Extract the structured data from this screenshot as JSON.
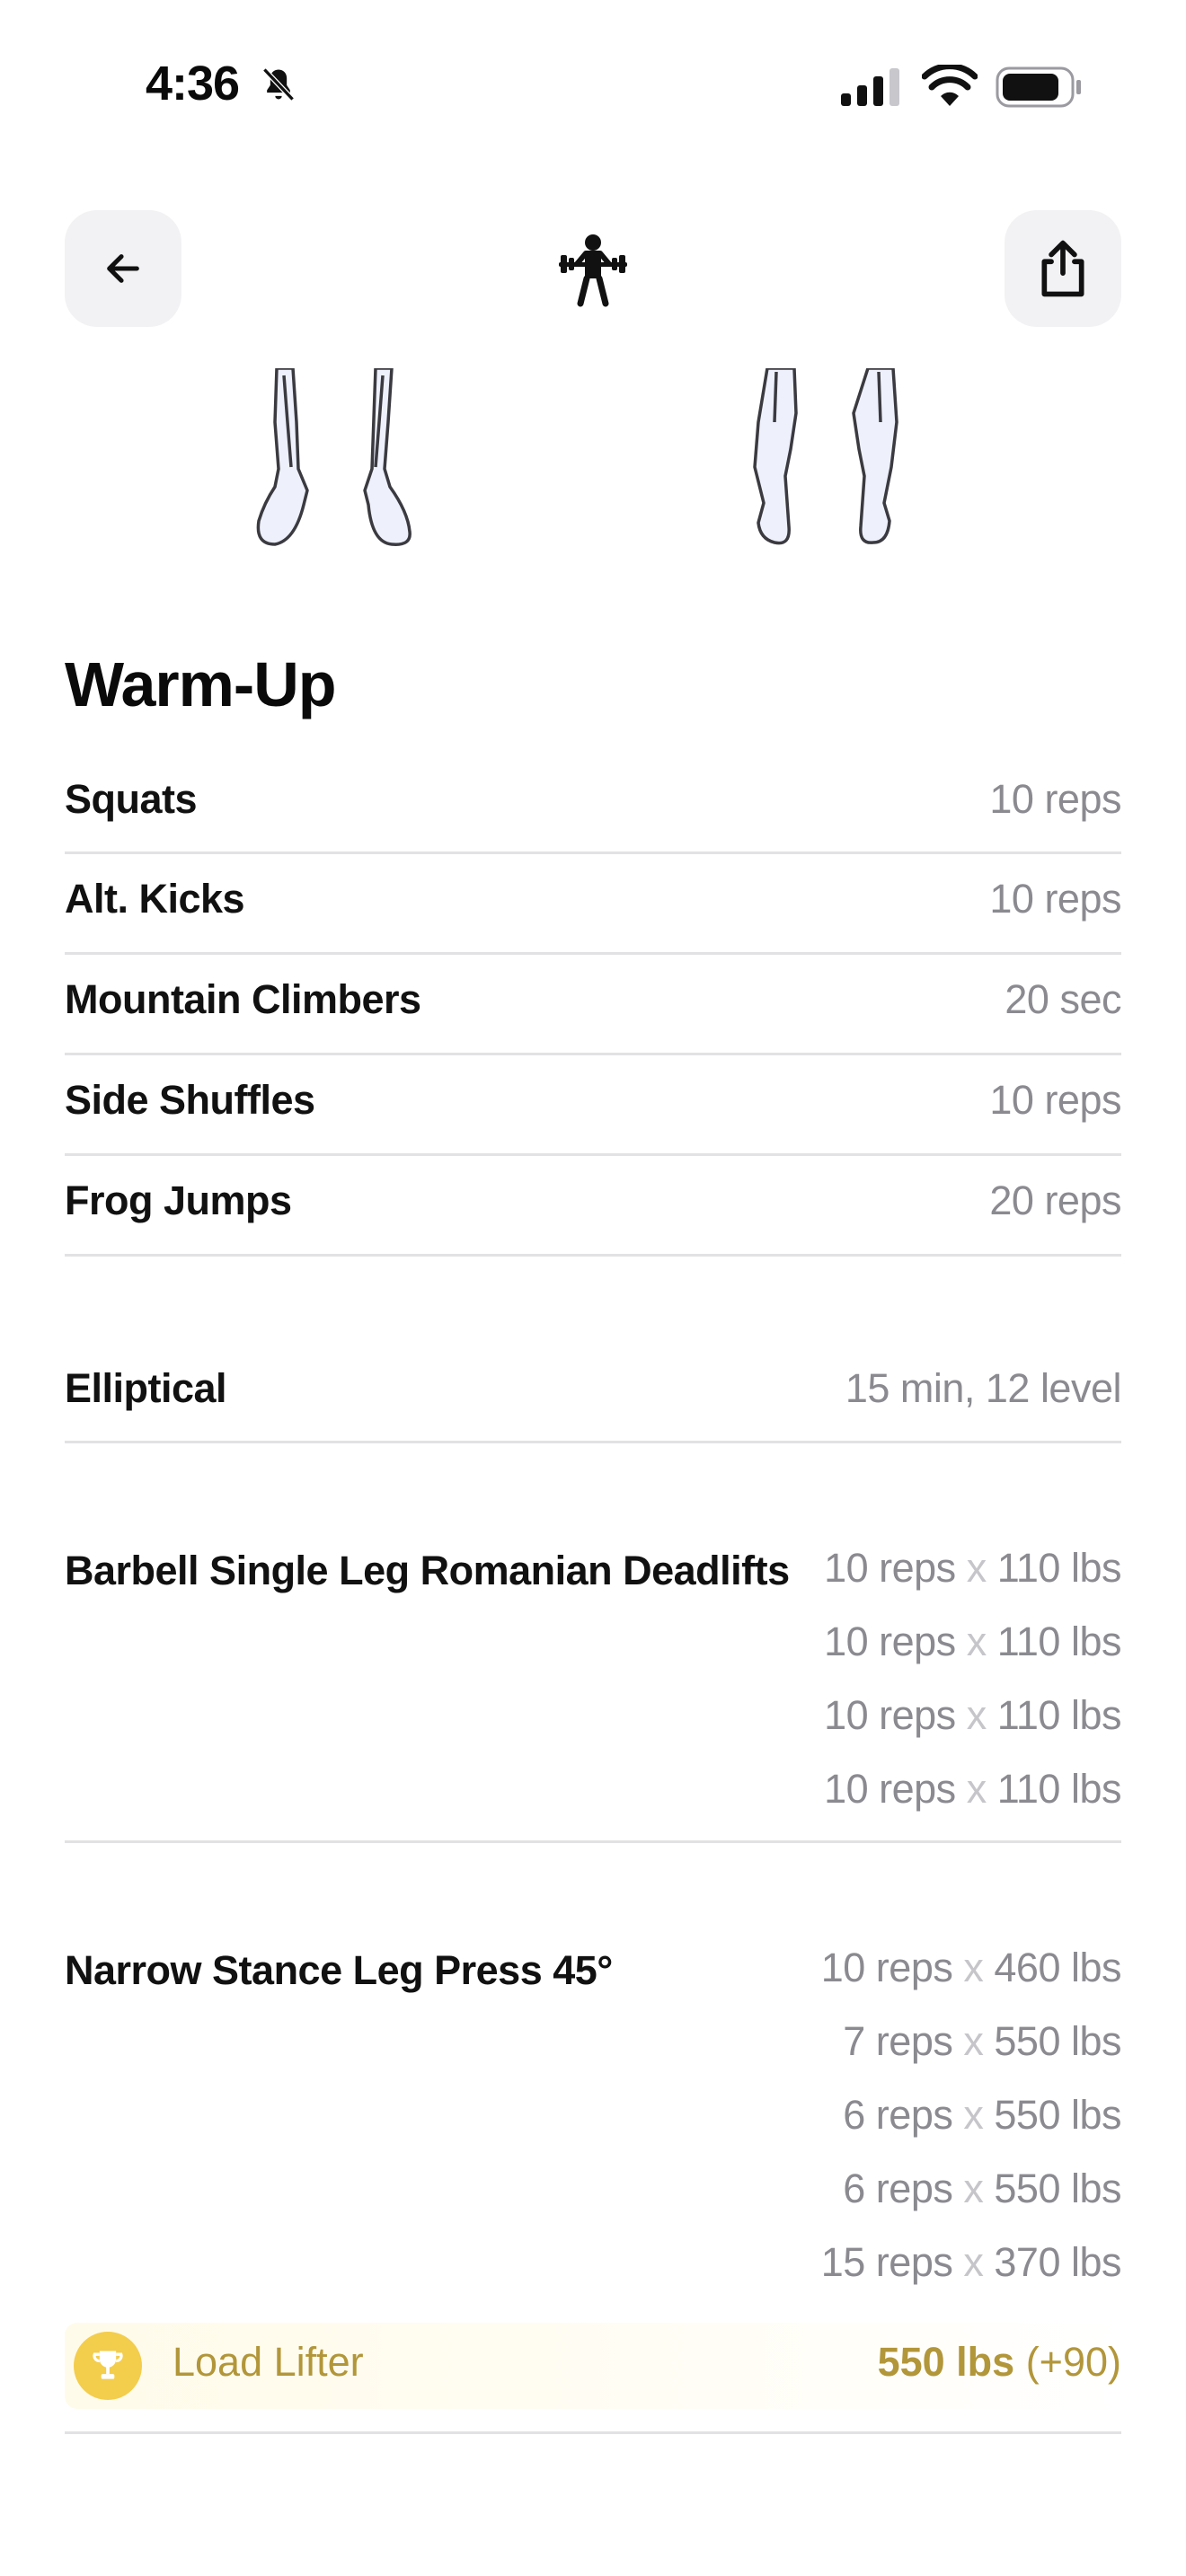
{
  "status_bar": {
    "time": "4:36"
  },
  "header": {
    "back_icon": "arrow-left-icon",
    "center_icon": "weightlifter-icon",
    "share_icon": "share-icon"
  },
  "colors": {
    "accent_gold": "#b2963a",
    "trophy": "#f3cd4c",
    "muted": "#8a8a90",
    "divider": "#e2e2e4"
  },
  "warmup": {
    "title": "Warm-Up",
    "items": [
      {
        "name": "Squats",
        "value": "10 reps"
      },
      {
        "name": "Alt. Kicks",
        "value": "10 reps"
      },
      {
        "name": "Mountain Climbers",
        "value": "20 sec"
      },
      {
        "name": "Side Shuffles",
        "value": "10 reps"
      },
      {
        "name": "Frog Jumps",
        "value": "20 reps"
      }
    ]
  },
  "elliptical": {
    "name": "Elliptical",
    "value": "15 min, 12 level"
  },
  "exercises": [
    {
      "name": "Barbell Single Leg Romanian Deadlifts",
      "sets": [
        {
          "reps": "10 reps",
          "x": "x",
          "weight": "110 lbs"
        },
        {
          "reps": "10 reps",
          "x": "x",
          "weight": "110 lbs"
        },
        {
          "reps": "10 reps",
          "x": "x",
          "weight": "110 lbs"
        },
        {
          "reps": "10 reps",
          "x": "x",
          "weight": "110 lbs"
        }
      ]
    },
    {
      "name": "Narrow Stance Leg Press 45°",
      "sets": [
        {
          "reps": "10 reps",
          "x": "x",
          "weight": "460 lbs"
        },
        {
          "reps": "7 reps",
          "x": "x",
          "weight": "550 lbs"
        },
        {
          "reps": "6 reps",
          "x": "x",
          "weight": "550 lbs"
        },
        {
          "reps": "6 reps",
          "x": "x",
          "weight": "550 lbs"
        },
        {
          "reps": "15 reps",
          "x": "x",
          "weight": "370 lbs"
        }
      ],
      "achievement": {
        "icon": "trophy-icon",
        "label": "Load Lifter",
        "value": "550 lbs",
        "delta": "(+90)"
      }
    }
  ]
}
